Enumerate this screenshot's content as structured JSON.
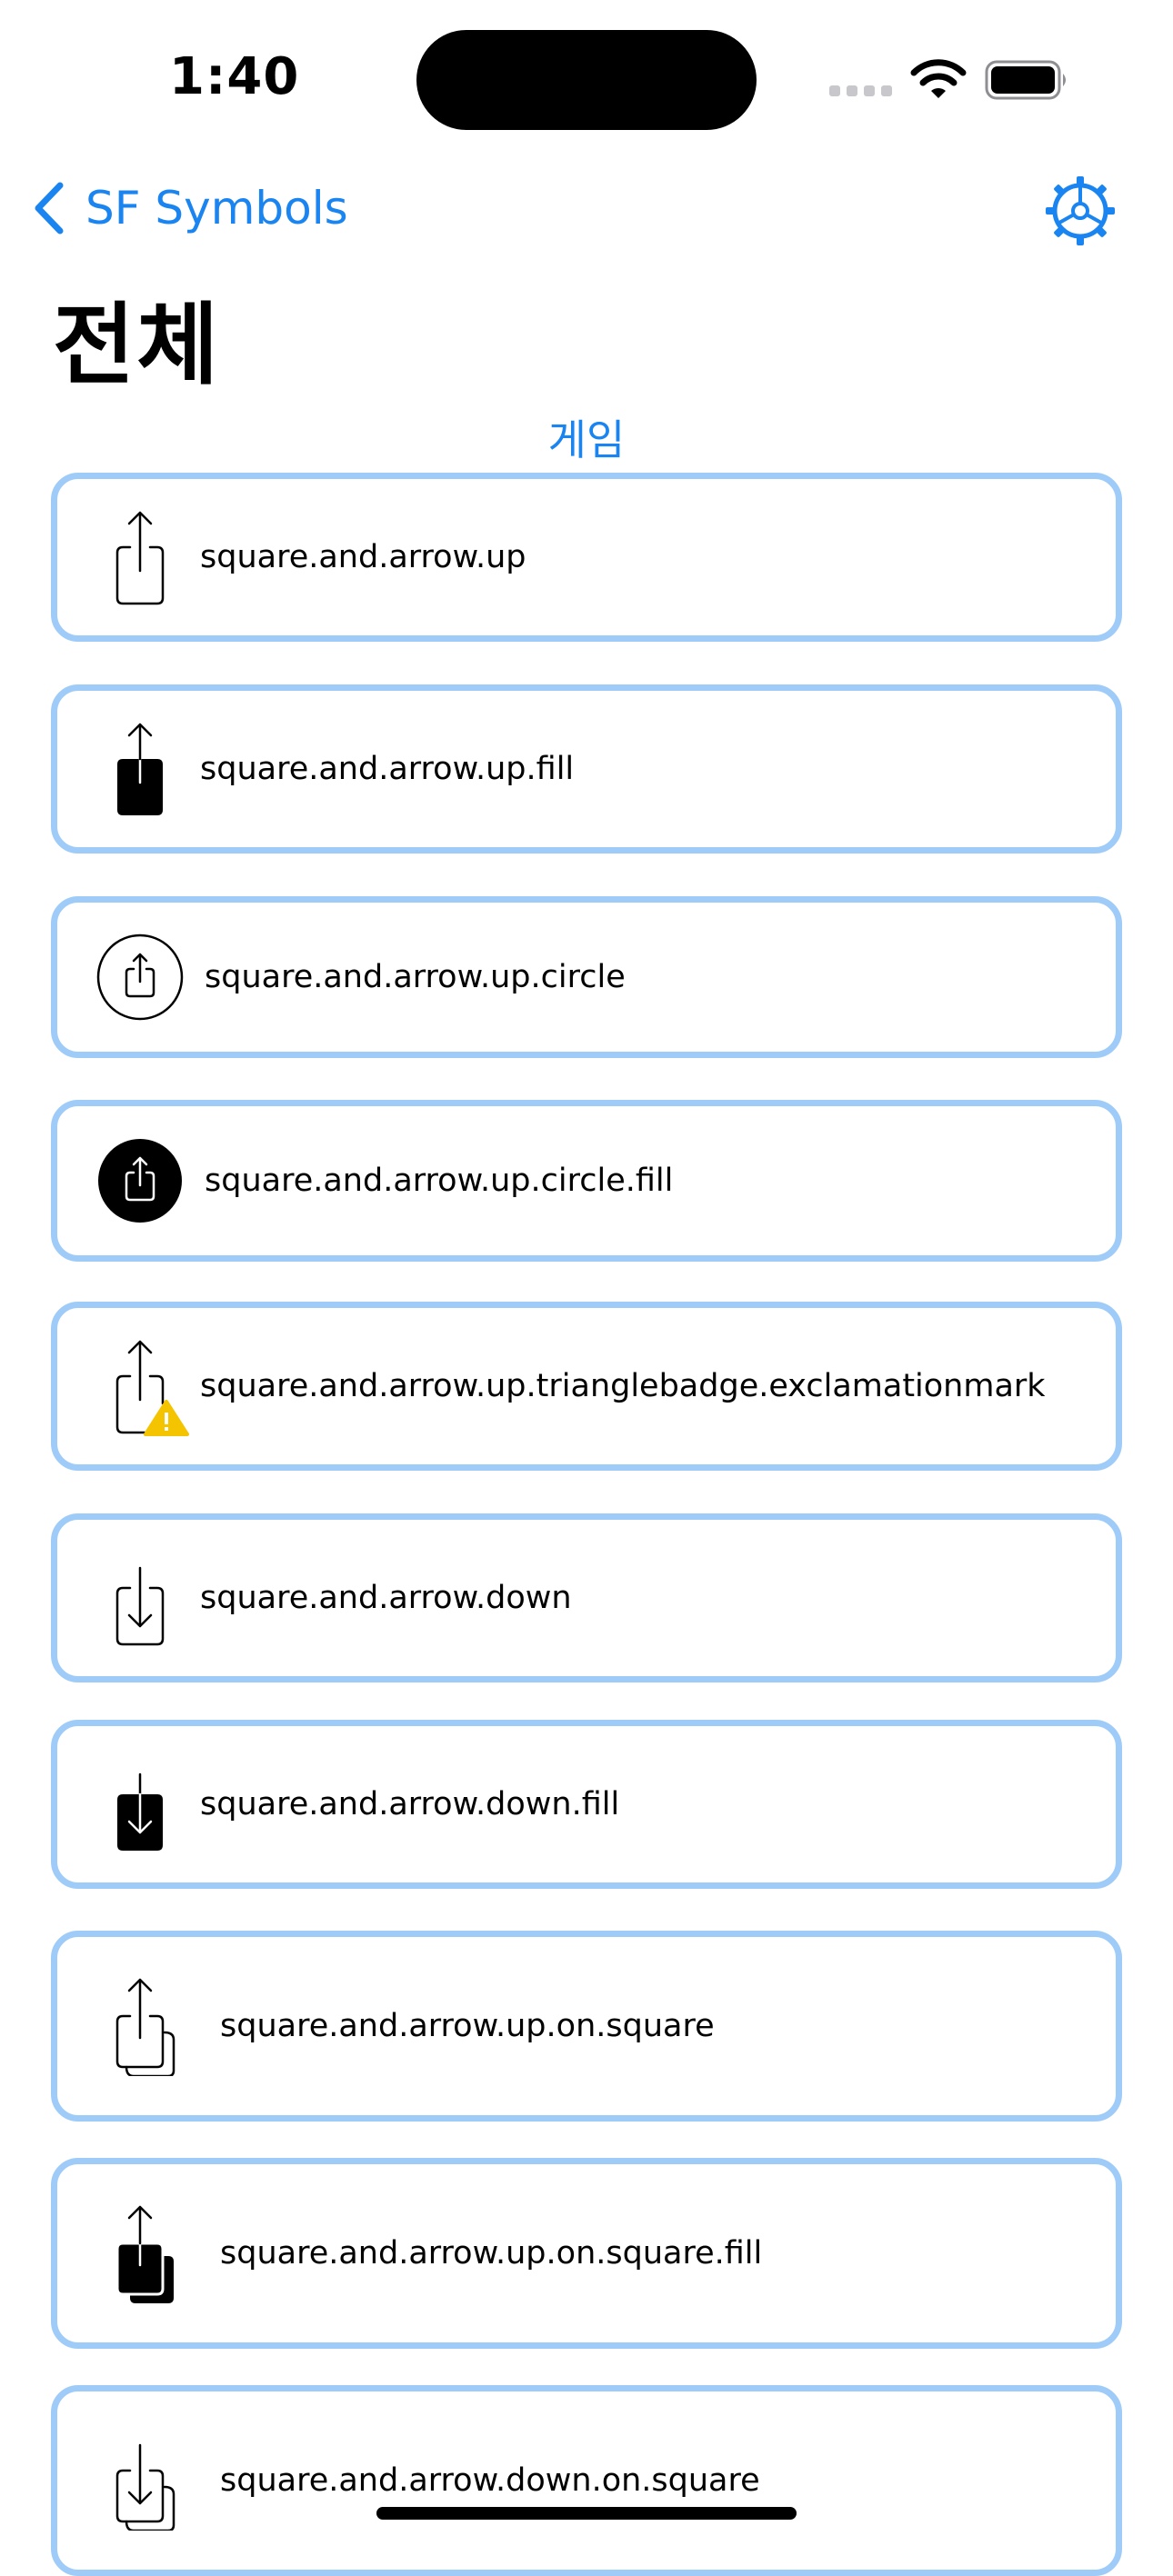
{
  "status_bar": {
    "time": "1:40"
  },
  "nav": {
    "back_label": "SF Symbols",
    "title": "전체",
    "settings_icon": "gear-icon"
  },
  "section": {
    "title": "게임"
  },
  "accent_color": "#1a84f0",
  "card_border_color": "#9fcbf8",
  "symbols": [
    {
      "name": "square.and.arrow.up",
      "icon": "square-and-arrow-up-icon"
    },
    {
      "name": "square.and.arrow.up.fill",
      "icon": "square-and-arrow-up-fill-icon"
    },
    {
      "name": "square.and.arrow.up.circle",
      "icon": "square-and-arrow-up-circle-icon"
    },
    {
      "name": "square.and.arrow.up.circle.fill",
      "icon": "square-and-arrow-up-circle-fill-icon"
    },
    {
      "name": "square.and.arrow.up.trianglebadge.exclamationmark",
      "icon": "square-and-arrow-up-trianglebadge-exclamationmark-icon"
    },
    {
      "name": "square.and.arrow.down",
      "icon": "square-and-arrow-down-icon"
    },
    {
      "name": "square.and.arrow.down.fill",
      "icon": "square-and-arrow-down-fill-icon"
    },
    {
      "name": "square.and.arrow.up.on.square",
      "icon": "square-and-arrow-up-on-square-icon"
    },
    {
      "name": "square.and.arrow.up.on.square.fill",
      "icon": "square-and-arrow-up-on-square-fill-icon"
    },
    {
      "name": "square.and.arrow.down.on.square",
      "icon": "square-and-arrow-down-on-square-icon"
    }
  ]
}
